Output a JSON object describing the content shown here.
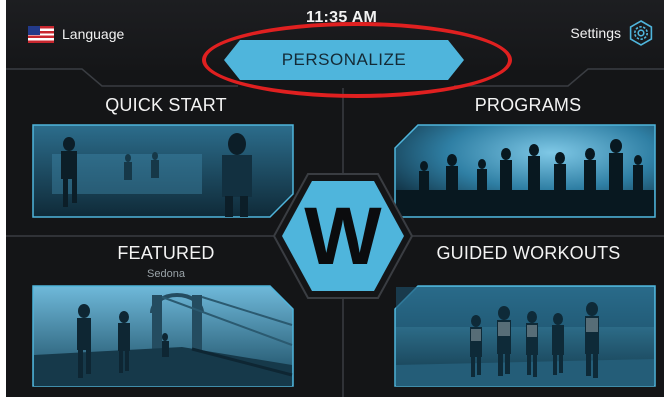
{
  "header": {
    "language_label": "Language",
    "clock": "11:35 AM",
    "settings_label": "Settings",
    "personalize_label": "PERSONALIZE"
  },
  "tiles": {
    "quick_start": {
      "title": "QUICK START"
    },
    "programs": {
      "title": "PROGRAMS"
    },
    "featured": {
      "title": "FEATURED",
      "subtitle": "Sedona"
    },
    "guided": {
      "title": "GUIDED WORKOUTS"
    }
  },
  "logo": {
    "letter": "W"
  },
  "colors": {
    "accent": "#4fb5dc",
    "background": "#141517",
    "highlight_ring": "#e02020"
  }
}
